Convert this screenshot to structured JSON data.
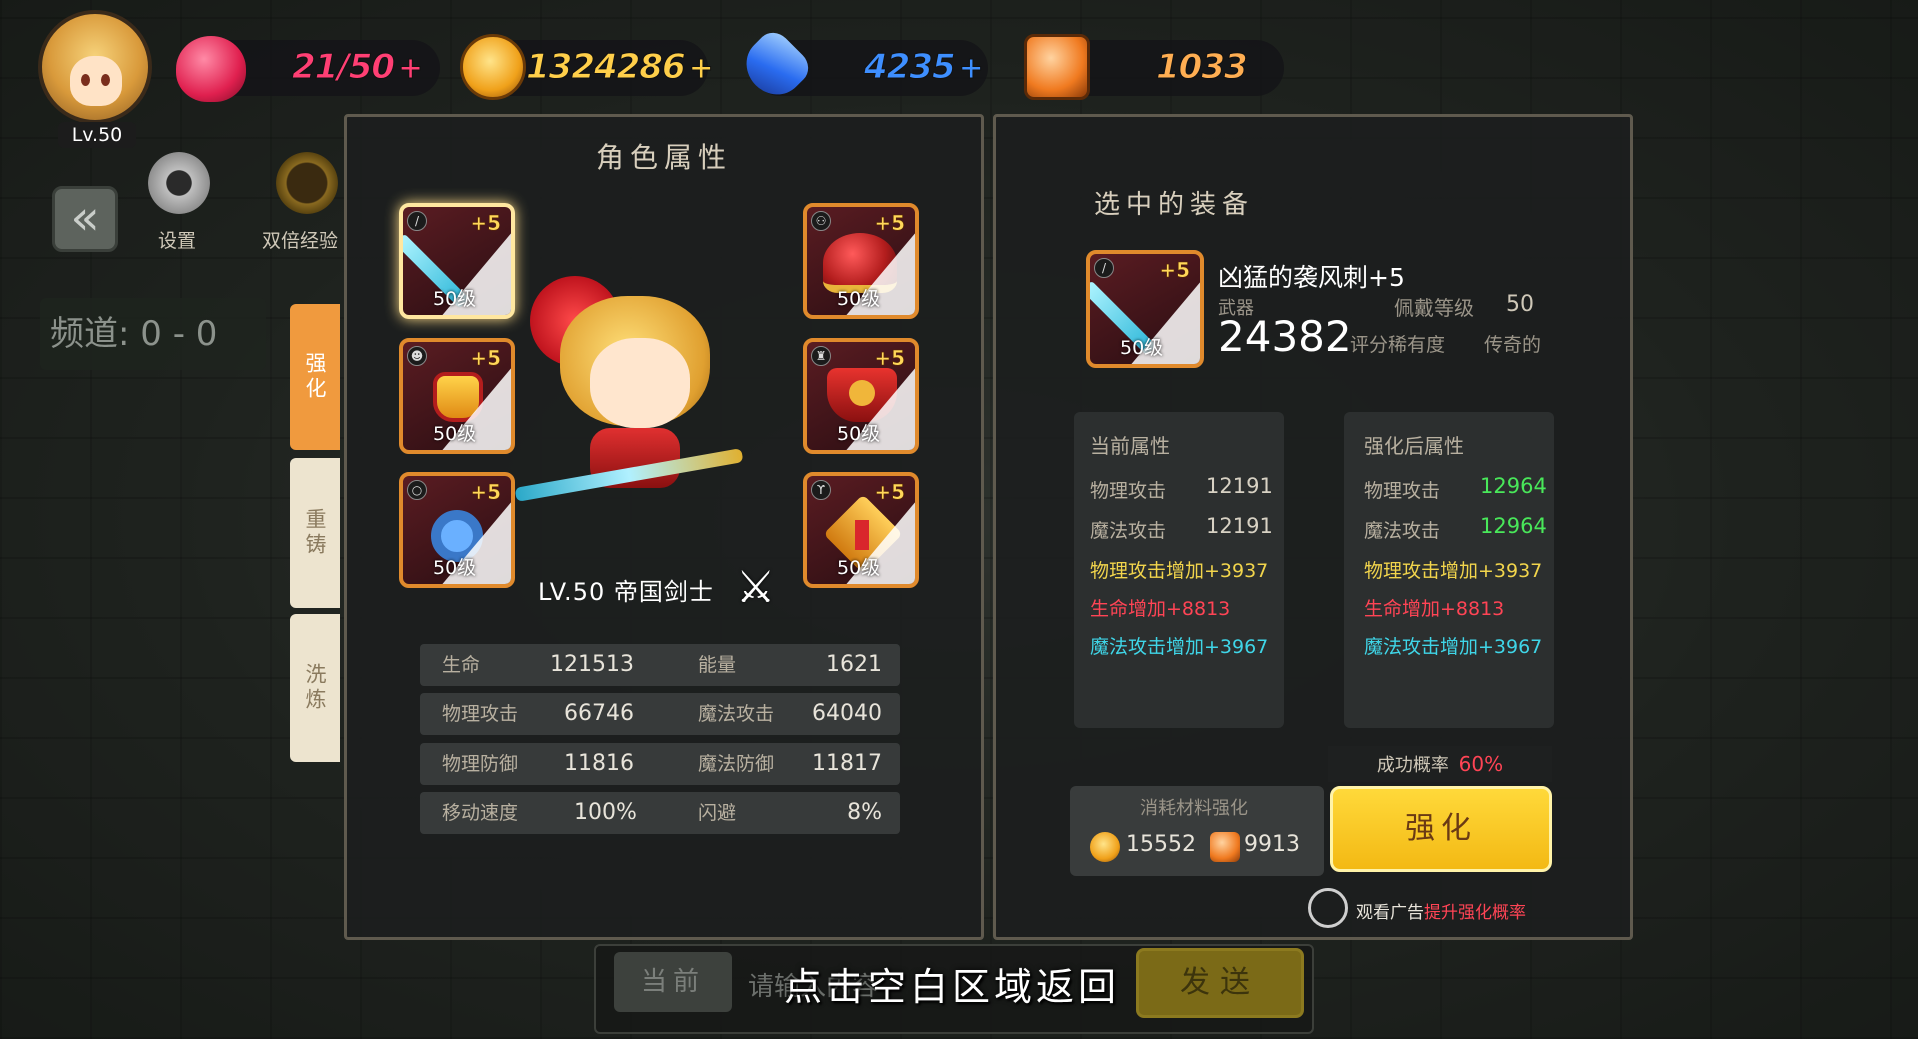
{
  "player": {
    "level": "Lv.50"
  },
  "resources": {
    "stamina": {
      "value": "21/50",
      "plus": "+",
      "icon": "heart-icon",
      "color": "#f0356f"
    },
    "gold": {
      "value": "1324286",
      "plus": "+",
      "icon": "gold-crown-coin-icon",
      "color": "#f7c54a"
    },
    "diamond": {
      "value": "4235",
      "plus": "+",
      "icon": "blue-diamond-icon",
      "color": "#3b8cff"
    },
    "crystal": {
      "value": "1033",
      "icon": "orange-crystal-icon",
      "color": "#f5a05a"
    }
  },
  "side_menu": {
    "settings_label": "设置",
    "double_exp_label": "双倍经验",
    "channel": "频道: 0 - 0"
  },
  "vertical_tabs": [
    "强化",
    "重铸",
    "洗炼"
  ],
  "left_panel": {
    "title": "角色属性",
    "hero_title": "LV.50 帝国剑士",
    "slots": [
      {
        "slot": "weapon",
        "enh": "+5",
        "level": "50级",
        "icon": "sword-icon"
      },
      {
        "slot": "helmet",
        "enh": "+5",
        "level": "50级",
        "icon": "helmet-icon"
      },
      {
        "slot": "accessory",
        "enh": "+5",
        "level": "50级",
        "icon": "crown-ornament-icon"
      },
      {
        "slot": "armor",
        "enh": "+5",
        "level": "50级",
        "icon": "armor-icon"
      },
      {
        "slot": "ring",
        "enh": "+5",
        "level": "50级",
        "icon": "ring-icon"
      },
      {
        "slot": "necklace",
        "enh": "+5",
        "level": "50级",
        "icon": "amulet-icon"
      }
    ],
    "stats": [
      {
        "k1": "生命",
        "v1": "121513",
        "k2": "能量",
        "v2": "1621"
      },
      {
        "k1": "物理攻击",
        "v1": "66746",
        "k2": "魔法攻击",
        "v2": "64040"
      },
      {
        "k1": "物理防御",
        "v1": "11816",
        "k2": "魔法防御",
        "v2": "11817"
      },
      {
        "k1": "移动速度",
        "v1": "100%",
        "k2": "闪避",
        "v2": "8%"
      }
    ]
  },
  "right_panel": {
    "title": "选中的装备",
    "item": {
      "name": "凶猛的袭风刺+5",
      "type": "武器",
      "wear_level_label": "佩戴等级",
      "wear_level": "50",
      "score": "24382",
      "rarity_label": "评分稀有度",
      "rarity": "传奇的",
      "enh": "+5",
      "level": "50级"
    },
    "current": {
      "header": "当前属性",
      "phys_atk_label": "物理攻击",
      "phys_atk": "12191",
      "mag_atk_label": "魔法攻击",
      "mag_atk": "12191",
      "bonus1": "物理攻击增加+3937",
      "bonus2": "生命增加+8813",
      "bonus3": "魔法攻击增加+3967"
    },
    "after": {
      "header": "强化后属性",
      "phys_atk_label": "物理攻击",
      "phys_atk": "12964",
      "mag_atk_label": "魔法攻击",
      "mag_atk": "12964",
      "bonus1": "物理攻击增加+3937",
      "bonus2": "生命增加+8813",
      "bonus3": "魔法攻击增加+3967"
    },
    "success_label": "成功概率",
    "success_rate": "60%",
    "cost_header": "消耗材料强化",
    "cost_gold": "15552",
    "cost_crystal": "9913",
    "enhance_button": "强化",
    "ad_text_1": "观看广告",
    "ad_text_2": "提升强化概率"
  },
  "bottom": {
    "chat_tab": "当前",
    "chat_placeholder": "请输入内容",
    "send_button": "发送",
    "return_hint": "点击空白区域返回"
  },
  "colors": {
    "green": "#49e85a",
    "yellow": "#f2d54c",
    "red": "#ff4455",
    "cyan": "#3fd6e8",
    "gold_button": "#f5c51b"
  }
}
